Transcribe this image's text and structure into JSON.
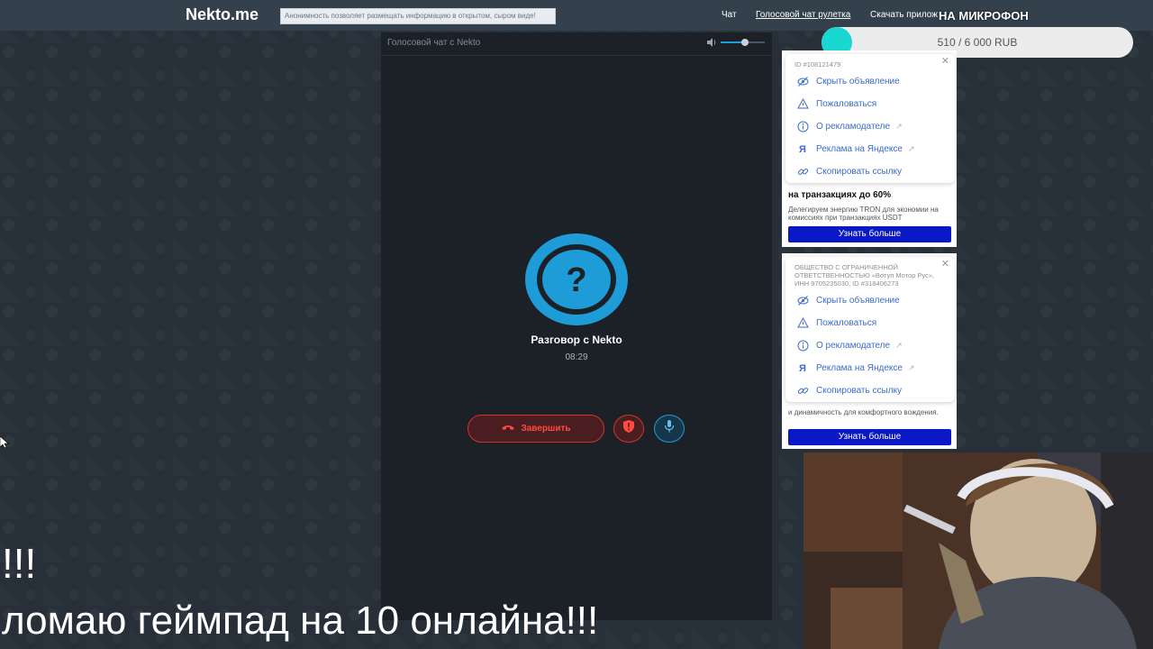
{
  "header": {
    "logo": "Nekto.me",
    "notice": "Анонимность позволяет размещать информацию в открытом, сыром виде!",
    "nav": [
      "Чат",
      "Голосовой чат рулетка",
      "Скачать прилож"
    ]
  },
  "donation": {
    "title": "НА МИКРОФОН",
    "progress_text": "510 / 6 000 RUB",
    "progress_fraction": 0.085
  },
  "call": {
    "title": "Голосовой чат с Nekto",
    "volume_fraction": 0.55,
    "avatar_icon": "question-mark-icon",
    "name": "Разговор с Nekto",
    "timer": "08:29",
    "end_label": "Завершить"
  },
  "ads": [
    {
      "meta": "ID #108121479",
      "menu": [
        "Скрыть объявление",
        "Пожаловаться",
        "О рекламодателе",
        "Реклама на Яндексе",
        "Скопировать ссылку"
      ],
      "headline": "на транзакциях до 60%",
      "body": "Делегируем энергию TRON для экономии на комиссиях при транзакциях USDT",
      "cta": "Узнать больше"
    },
    {
      "meta": "ОБЩЕСТВО С ОГРАНИЧЕННОЙ ОТВЕТСТВЕННОСТЬЮ «Вотуп Мотор Рус», ИНН 9705235030, ID #318406273",
      "menu": [
        "Скрыть объявление",
        "Пожаловаться",
        "О рекламодателе",
        "Реклама на Яндексе",
        "Скопировать ссылку"
      ],
      "body": "и динамичность для комфортного вождения.",
      "cta": "Узнать больше"
    }
  ],
  "captions": {
    "line1": "!!!",
    "line2": "ломаю геймпад на 10 онлайна!!!"
  },
  "colors": {
    "accent": "#1e9cd7",
    "danger": "#d4322d",
    "progress": "#19d7d1",
    "ad_button": "#0a18c8"
  }
}
